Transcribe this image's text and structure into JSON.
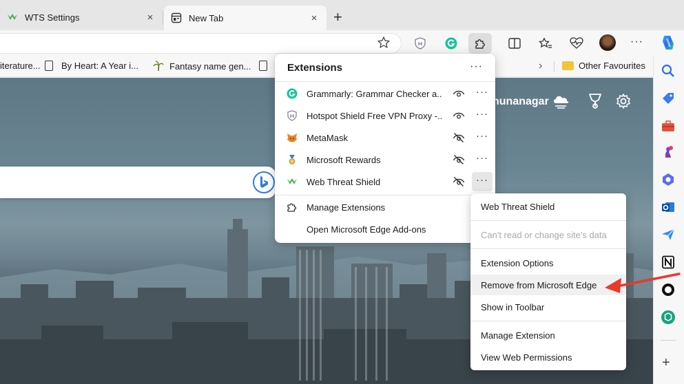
{
  "tabs": [
    {
      "title": "WTS Settings",
      "close": "×",
      "active": false
    },
    {
      "title": "New Tab",
      "close": "×",
      "active": true
    }
  ],
  "new_tab_symbol": "+",
  "toolbar": {
    "more_symbol": "···"
  },
  "bookmarks": [
    {
      "label": "iterature..."
    },
    {
      "label": "By Heart: A Year i..."
    },
    {
      "label": "Fantasy name gen..."
    },
    {
      "label": ""
    }
  ],
  "bookmarks_chevron": "›",
  "other_favourites": "Other Favourites",
  "content": {
    "weather_location": "nunanagar"
  },
  "extensions_panel": {
    "title": "Extensions",
    "header_more": "···",
    "items": [
      {
        "name": "Grammarly: Grammar Checker a...",
        "icon": "grammarly-icon",
        "visible_in_toolbar": true,
        "more": "···"
      },
      {
        "name": "Hotspot Shield Free VPN Proxy -...",
        "icon": "hotspot-shield-icon",
        "visible_in_toolbar": true,
        "more": "···"
      },
      {
        "name": "MetaMask",
        "icon": "metamask-fox-icon",
        "visible_in_toolbar": false,
        "more": "···"
      },
      {
        "name": "Microsoft Rewards",
        "icon": "rewards-medal-icon",
        "visible_in_toolbar": false,
        "more": "···"
      },
      {
        "name": "Web Threat Shield",
        "icon": "web-threat-shield-icon",
        "visible_in_toolbar": false,
        "more": "···"
      }
    ],
    "manage": "Manage Extensions",
    "addons": "Open Microsoft Edge Add-ons"
  },
  "context_menu": {
    "header": "Web Threat Shield",
    "disabled": "Can't read or change site's data",
    "options": "Extension Options",
    "remove": "Remove from Microsoft Edge",
    "show_toolbar": "Show in Toolbar",
    "manage": "Manage Extension",
    "permissions": "View Web Permissions"
  },
  "colors": {
    "grammarly": "#15c39a",
    "wts_green": "#4caf50",
    "arrow": "#e8392c",
    "folder": "#f2c43a"
  },
  "sidebar_plus": "+"
}
